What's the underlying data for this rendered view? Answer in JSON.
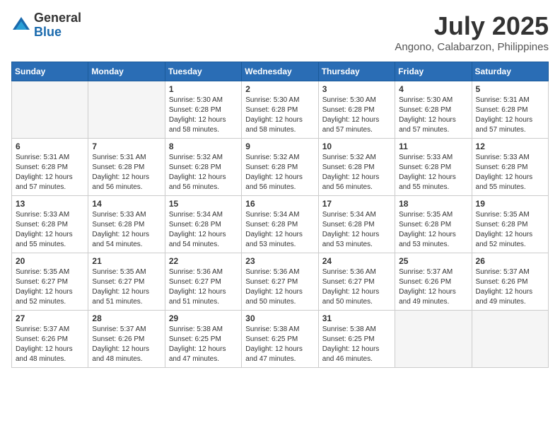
{
  "header": {
    "logo_general": "General",
    "logo_blue": "Blue",
    "month": "July 2025",
    "location": "Angono, Calabarzon, Philippines"
  },
  "weekdays": [
    "Sunday",
    "Monday",
    "Tuesday",
    "Wednesday",
    "Thursday",
    "Friday",
    "Saturday"
  ],
  "weeks": [
    [
      {
        "day": "",
        "empty": true
      },
      {
        "day": "",
        "empty": true
      },
      {
        "day": "1",
        "sunrise": "5:30 AM",
        "sunset": "6:28 PM",
        "daylight": "12 hours and 58 minutes."
      },
      {
        "day": "2",
        "sunrise": "5:30 AM",
        "sunset": "6:28 PM",
        "daylight": "12 hours and 58 minutes."
      },
      {
        "day": "3",
        "sunrise": "5:30 AM",
        "sunset": "6:28 PM",
        "daylight": "12 hours and 57 minutes."
      },
      {
        "day": "4",
        "sunrise": "5:30 AM",
        "sunset": "6:28 PM",
        "daylight": "12 hours and 57 minutes."
      },
      {
        "day": "5",
        "sunrise": "5:31 AM",
        "sunset": "6:28 PM",
        "daylight": "12 hours and 57 minutes."
      }
    ],
    [
      {
        "day": "6",
        "sunrise": "5:31 AM",
        "sunset": "6:28 PM",
        "daylight": "12 hours and 57 minutes."
      },
      {
        "day": "7",
        "sunrise": "5:31 AM",
        "sunset": "6:28 PM",
        "daylight": "12 hours and 56 minutes."
      },
      {
        "day": "8",
        "sunrise": "5:32 AM",
        "sunset": "6:28 PM",
        "daylight": "12 hours and 56 minutes."
      },
      {
        "day": "9",
        "sunrise": "5:32 AM",
        "sunset": "6:28 PM",
        "daylight": "12 hours and 56 minutes."
      },
      {
        "day": "10",
        "sunrise": "5:32 AM",
        "sunset": "6:28 PM",
        "daylight": "12 hours and 56 minutes."
      },
      {
        "day": "11",
        "sunrise": "5:33 AM",
        "sunset": "6:28 PM",
        "daylight": "12 hours and 55 minutes."
      },
      {
        "day": "12",
        "sunrise": "5:33 AM",
        "sunset": "6:28 PM",
        "daylight": "12 hours and 55 minutes."
      }
    ],
    [
      {
        "day": "13",
        "sunrise": "5:33 AM",
        "sunset": "6:28 PM",
        "daylight": "12 hours and 55 minutes."
      },
      {
        "day": "14",
        "sunrise": "5:33 AM",
        "sunset": "6:28 PM",
        "daylight": "12 hours and 54 minutes."
      },
      {
        "day": "15",
        "sunrise": "5:34 AM",
        "sunset": "6:28 PM",
        "daylight": "12 hours and 54 minutes."
      },
      {
        "day": "16",
        "sunrise": "5:34 AM",
        "sunset": "6:28 PM",
        "daylight": "12 hours and 53 minutes."
      },
      {
        "day": "17",
        "sunrise": "5:34 AM",
        "sunset": "6:28 PM",
        "daylight": "12 hours and 53 minutes."
      },
      {
        "day": "18",
        "sunrise": "5:35 AM",
        "sunset": "6:28 PM",
        "daylight": "12 hours and 53 minutes."
      },
      {
        "day": "19",
        "sunrise": "5:35 AM",
        "sunset": "6:28 PM",
        "daylight": "12 hours and 52 minutes."
      }
    ],
    [
      {
        "day": "20",
        "sunrise": "5:35 AM",
        "sunset": "6:27 PM",
        "daylight": "12 hours and 52 minutes."
      },
      {
        "day": "21",
        "sunrise": "5:35 AM",
        "sunset": "6:27 PM",
        "daylight": "12 hours and 51 minutes."
      },
      {
        "day": "22",
        "sunrise": "5:36 AM",
        "sunset": "6:27 PM",
        "daylight": "12 hours and 51 minutes."
      },
      {
        "day": "23",
        "sunrise": "5:36 AM",
        "sunset": "6:27 PM",
        "daylight": "12 hours and 50 minutes."
      },
      {
        "day": "24",
        "sunrise": "5:36 AM",
        "sunset": "6:27 PM",
        "daylight": "12 hours and 50 minutes."
      },
      {
        "day": "25",
        "sunrise": "5:37 AM",
        "sunset": "6:26 PM",
        "daylight": "12 hours and 49 minutes."
      },
      {
        "day": "26",
        "sunrise": "5:37 AM",
        "sunset": "6:26 PM",
        "daylight": "12 hours and 49 minutes."
      }
    ],
    [
      {
        "day": "27",
        "sunrise": "5:37 AM",
        "sunset": "6:26 PM",
        "daylight": "12 hours and 48 minutes."
      },
      {
        "day": "28",
        "sunrise": "5:37 AM",
        "sunset": "6:26 PM",
        "daylight": "12 hours and 48 minutes."
      },
      {
        "day": "29",
        "sunrise": "5:38 AM",
        "sunset": "6:25 PM",
        "daylight": "12 hours and 47 minutes."
      },
      {
        "day": "30",
        "sunrise": "5:38 AM",
        "sunset": "6:25 PM",
        "daylight": "12 hours and 47 minutes."
      },
      {
        "day": "31",
        "sunrise": "5:38 AM",
        "sunset": "6:25 PM",
        "daylight": "12 hours and 46 minutes."
      },
      {
        "day": "",
        "empty": true
      },
      {
        "day": "",
        "empty": true
      }
    ]
  ]
}
